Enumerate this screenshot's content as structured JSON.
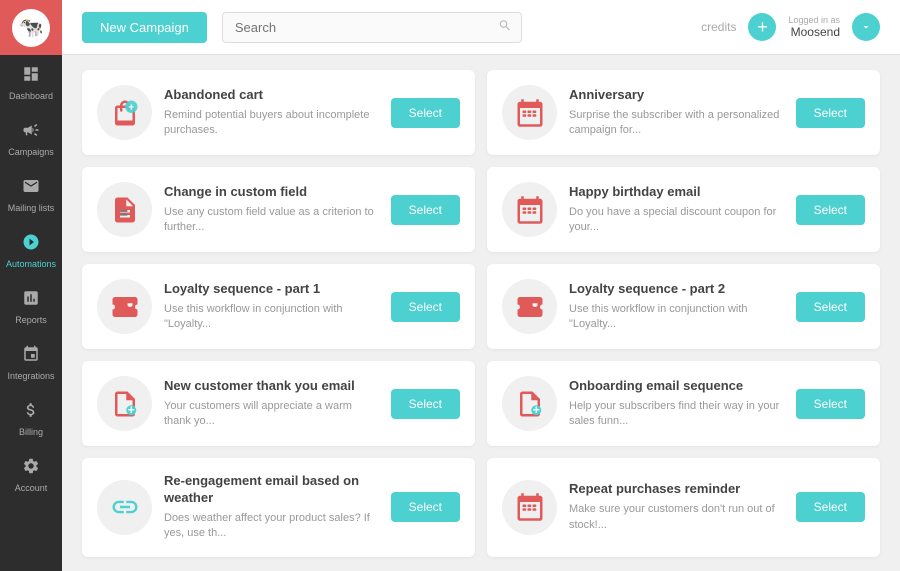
{
  "sidebar": {
    "logo": "🐄",
    "items": [
      {
        "id": "dashboard",
        "label": "Dashboard",
        "icon": "📊",
        "active": false
      },
      {
        "id": "campaigns",
        "label": "Campaigns",
        "icon": "📢",
        "active": false
      },
      {
        "id": "mailing-lists",
        "label": "Mailing lists",
        "icon": "✉",
        "active": false
      },
      {
        "id": "automations",
        "label": "Automations",
        "icon": "🕐",
        "active": true
      },
      {
        "id": "reports",
        "label": "Reports",
        "icon": "📈",
        "active": false
      },
      {
        "id": "integrations",
        "label": "Integrations",
        "icon": "⚙",
        "active": false
      },
      {
        "id": "billing",
        "label": "Billing",
        "icon": "$",
        "active": false
      },
      {
        "id": "account",
        "label": "Account",
        "icon": "⚙",
        "active": false
      }
    ]
  },
  "topbar": {
    "new_campaign_label": "New Campaign",
    "search_placeholder": "Search",
    "credits_label": "credits",
    "logged_in_label": "Logged in as",
    "username": "Moosend"
  },
  "cards": [
    {
      "id": "abandoned-cart",
      "title": "Abandoned cart",
      "description": "Remind potential buyers about incomplete purchases.",
      "icon": "🛍",
      "icon_type": "bag",
      "select_label": "Select"
    },
    {
      "id": "anniversary",
      "title": "Anniversary",
      "description": "Surprise the subscriber with a personalized campaign for...",
      "icon": "📅",
      "icon_type": "calendar",
      "select_label": "Select"
    },
    {
      "id": "change-custom-field",
      "title": "Change in custom field",
      "description": "Use any custom field value as a criterion to further...",
      "icon": "📋",
      "icon_type": "form",
      "select_label": "Select"
    },
    {
      "id": "happy-birthday",
      "title": "Happy birthday email",
      "description": "Do you have a special discount coupon for your...",
      "icon": "📅",
      "icon_type": "calendar",
      "select_label": "Select"
    },
    {
      "id": "loyalty-part1",
      "title": "Loyalty sequence - part 1",
      "description": "Use this workflow in conjunction with \"Loyalty...",
      "icon": "🎫",
      "icon_type": "ticket",
      "select_label": "Select"
    },
    {
      "id": "loyalty-part2",
      "title": "Loyalty sequence - part 2",
      "description": "Use this workflow in conjunction with \"Loyalty...",
      "icon": "🎫",
      "icon_type": "ticket",
      "select_label": "Select"
    },
    {
      "id": "new-customer-thank-you",
      "title": "New customer thank you email",
      "description": "Your customers will appreciate a warm thank yo...",
      "icon": "📄",
      "icon_type": "doc-plus",
      "select_label": "Select"
    },
    {
      "id": "onboarding-email",
      "title": "Onboarding email sequence",
      "description": "Help your subscribers find their way in your sales funn...",
      "icon": "📄",
      "icon_type": "doc-plus",
      "select_label": "Select"
    },
    {
      "id": "re-engagement",
      "title": "Re-engagement email based on weather",
      "description": "Does weather affect your product sales? If yes, use th...",
      "icon": "🔗",
      "icon_type": "link",
      "select_label": "Select"
    },
    {
      "id": "repeat-purchases",
      "title": "Repeat purchases reminder",
      "description": "Make sure your customers don't run out of stock!...",
      "icon": "📅",
      "icon_type": "calendar",
      "select_label": "Select"
    }
  ]
}
